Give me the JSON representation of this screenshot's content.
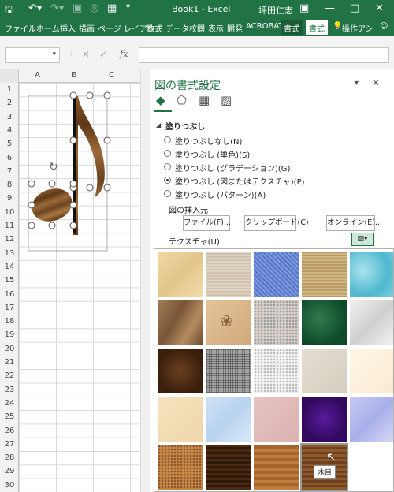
{
  "title_bar": {
    "doc_title": "Book1 - Excel",
    "user": "坪田仁志"
  },
  "tabs": [
    "ファイル",
    "ホーム",
    "挿入",
    "描画",
    "ページ レイアウト",
    "数式",
    "データ",
    "校閲",
    "表示",
    "開発",
    "ACROBAT",
    "書式",
    "書式"
  ],
  "tell_me": "操作アシ",
  "formula": {
    "fx": "fx"
  },
  "columns": [
    "A",
    "B",
    "C"
  ],
  "rows": [
    "1",
    "2",
    "3",
    "4",
    "5",
    "6",
    "7",
    "8",
    "9",
    "10",
    "11",
    "12",
    "13",
    "14",
    "15",
    "16",
    "17",
    "18",
    "19",
    "20",
    "21",
    "22",
    "23",
    "24",
    "25",
    "26",
    "27",
    "28",
    "29",
    "30"
  ],
  "pane": {
    "title": "図の書式設定",
    "section": "塗りつぶし",
    "options": [
      "塗りつぶしなし(N)",
      "塗りつぶし (単色)(S)",
      "塗りつぶし (グラデーション)(G)",
      "塗りつぶし (図またはテクスチャ)(P)",
      "塗りつぶし (パターン)(A)"
    ],
    "selected_option": "塗りつぶし (図またはテクスチャ)(P)",
    "insert_from_label": "図の挿入元",
    "file_btn": "ファイル(F)...",
    "clipboard_btn": "クリップボード(C)",
    "online_btn": "オンライン(E)...",
    "texture_label": "テクスチャ(U)",
    "tooltip": "木目"
  }
}
